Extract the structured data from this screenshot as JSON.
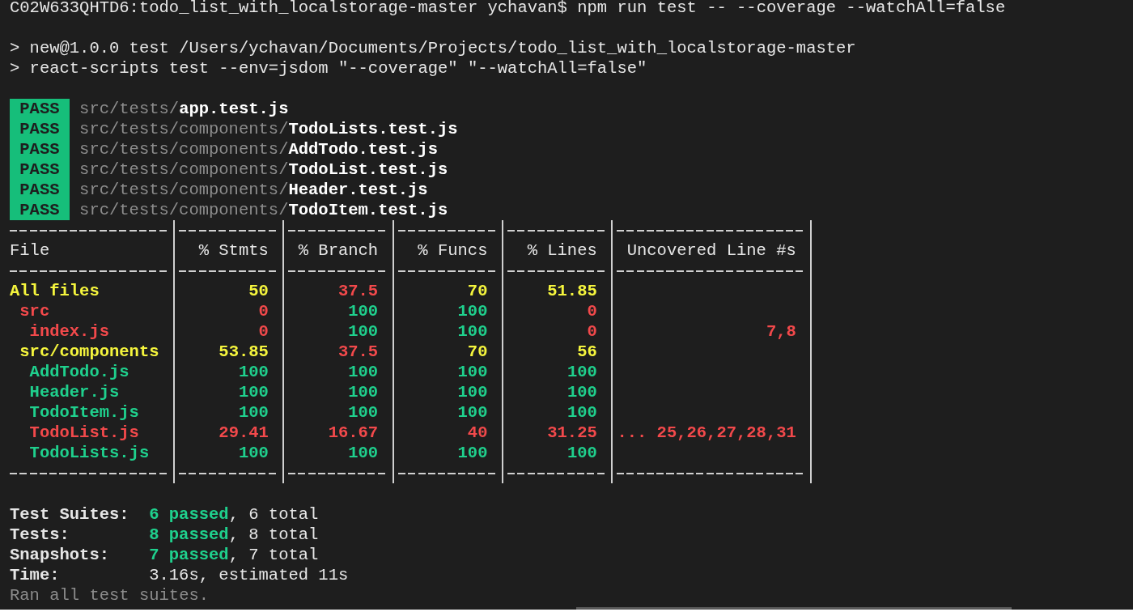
{
  "command_line": "C02W633QHTD6:todo_list_with_localstorage-master ychavan$ npm run test -- --coverage --watchAll=false",
  "script_lines": [
    "> new@1.0.0 test /Users/ychavan/Documents/Projects/todo_list_with_localstorage-master",
    "> react-scripts test --env=jsdom \"--coverage\" \"--watchAll=false\""
  ],
  "test_results": [
    {
      "status": "PASS",
      "dir": "src/tests/",
      "file": "app.test.js"
    },
    {
      "status": "PASS",
      "dir": "src/tests/components/",
      "file": "TodoLists.test.js"
    },
    {
      "status": "PASS",
      "dir": "src/tests/components/",
      "file": "AddTodo.test.js"
    },
    {
      "status": "PASS",
      "dir": "src/tests/components/",
      "file": "TodoList.test.js"
    },
    {
      "status": "PASS",
      "dir": "src/tests/components/",
      "file": "Header.test.js"
    },
    {
      "status": "PASS",
      "dir": "src/tests/components/",
      "file": "TodoItem.test.js"
    }
  ],
  "coverage_table": {
    "columns": [
      "File",
      "% Stmts",
      "% Branch",
      "% Funcs",
      "% Lines",
      "Uncovered Line #s"
    ],
    "rows": [
      {
        "cells": [
          {
            "text": "All files",
            "color": "#f5f53d"
          },
          {
            "text": "50",
            "color": "#f5f53d"
          },
          {
            "text": "37.5",
            "color": "#f2494b"
          },
          {
            "text": "70",
            "color": "#f5f53d"
          },
          {
            "text": "51.85",
            "color": "#f5f53d"
          }
        ],
        "children": [
          {
            "cells": [
              {
                "text": "src",
                "color": "#f2494b"
              },
              {
                "text": "0",
                "color": "#f2494b"
              },
              {
                "text": "100",
                "color": "#1fd08d"
              },
              {
                "text": "100",
                "color": "#1fd08d"
              },
              {
                "text": "0",
                "color": "#f2494b"
              }
            ],
            "children": [
              {
                "cells": [
                  {
                    "text": "index.js",
                    "color": "#f2494b"
                  },
                  {
                    "text": "0",
                    "color": "#f2494b"
                  },
                  {
                    "text": "100",
                    "color": "#1fd08d"
                  },
                  {
                    "text": "100",
                    "color": "#1fd08d"
                  },
                  {
                    "text": "0",
                    "color": "#f2494b"
                  },
                  {
                    "text": "7,8",
                    "color": "#f2494b"
                  }
                ]
              }
            ]
          },
          {
            "cells": [
              {
                "text": "src/components",
                "color": "#f5f53d"
              },
              {
                "text": "53.85",
                "color": "#f5f53d"
              },
              {
                "text": "37.5",
                "color": "#f2494b"
              },
              {
                "text": "70",
                "color": "#f5f53d"
              },
              {
                "text": "56",
                "color": "#f5f53d"
              }
            ],
            "children": [
              {
                "cells": [
                  {
                    "text": "AddTodo.js",
                    "color": "#1fd08d"
                  },
                  {
                    "text": "100",
                    "color": "#1fd08d"
                  },
                  {
                    "text": "100",
                    "color": "#1fd08d"
                  },
                  {
                    "text": "100",
                    "color": "#1fd08d"
                  },
                  {
                    "text": "100",
                    "color": "#1fd08d"
                  }
                ]
              },
              {
                "cells": [
                  {
                    "text": "Header.js",
                    "color": "#1fd08d"
                  },
                  {
                    "text": "100",
                    "color": "#1fd08d"
                  },
                  {
                    "text": "100",
                    "color": "#1fd08d"
                  },
                  {
                    "text": "100",
                    "color": "#1fd08d"
                  },
                  {
                    "text": "100",
                    "color": "#1fd08d"
                  }
                ]
              },
              {
                "cells": [
                  {
                    "text": "TodoItem.js",
                    "color": "#1fd08d"
                  },
                  {
                    "text": "100",
                    "color": "#1fd08d"
                  },
                  {
                    "text": "100",
                    "color": "#1fd08d"
                  },
                  {
                    "text": "100",
                    "color": "#1fd08d"
                  },
                  {
                    "text": "100",
                    "color": "#1fd08d"
                  }
                ]
              },
              {
                "cells": [
                  {
                    "text": "TodoList.js",
                    "color": "#f2494b"
                  },
                  {
                    "text": "29.41",
                    "color": "#f2494b"
                  },
                  {
                    "text": "16.67",
                    "color": "#f2494b"
                  },
                  {
                    "text": "40",
                    "color": "#f2494b"
                  },
                  {
                    "text": "31.25",
                    "color": "#f2494b"
                  },
                  {
                    "text": "... 25,26,27,28,31",
                    "color": "#f2494b"
                  }
                ]
              },
              {
                "cells": [
                  {
                    "text": "TodoLists.js",
                    "color": "#1fd08d"
                  },
                  {
                    "text": "100",
                    "color": "#1fd08d"
                  },
                  {
                    "text": "100",
                    "color": "#1fd08d"
                  },
                  {
                    "text": "100",
                    "color": "#1fd08d"
                  },
                  {
                    "text": "100",
                    "color": "#1fd08d"
                  }
                ]
              }
            ]
          }
        ]
      }
    ]
  },
  "summary": [
    {
      "kind": "count",
      "label": "Test Suites:",
      "passed": "6 passed",
      "rest": ", 6 total"
    },
    {
      "kind": "count",
      "label": "Tests:",
      "passed": "8 passed",
      "rest": ", 8 total"
    },
    {
      "kind": "count",
      "label": "Snapshots:",
      "passed": "7 passed",
      "rest": ", 7 total"
    },
    {
      "kind": "time",
      "label": "Time:",
      "rest": "3.16s, estimated 11s"
    }
  ],
  "footer": "Ran all test suites."
}
